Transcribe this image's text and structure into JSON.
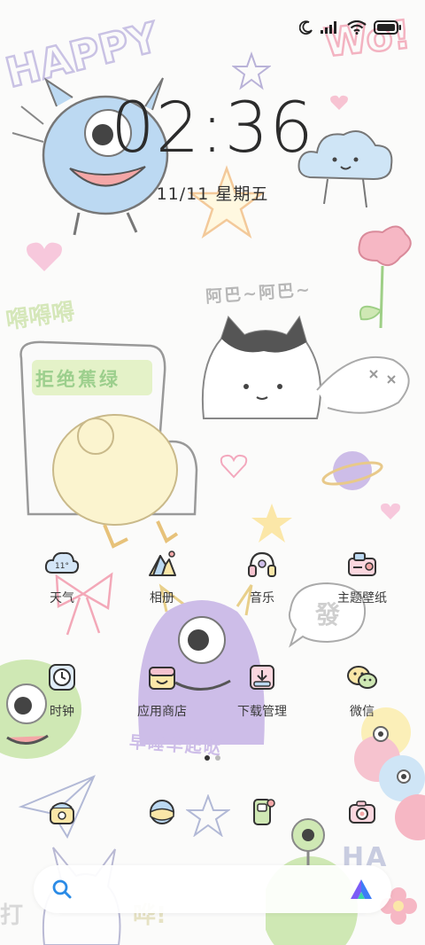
{
  "status": {
    "icons": [
      "moon-icon",
      "signal-icon",
      "wifi-icon",
      "battery-icon"
    ]
  },
  "lockscreen": {
    "time": "02:36",
    "date": "11/11 星期五"
  },
  "wallpaper_text": {
    "happy": "HAPPY",
    "wow": "Wo!",
    "aba": "阿巴~阿巴~",
    "liu": "嘚嘚嘚",
    "refuse": "拒绝蕉绿",
    "fa": "發",
    "sleep": "早睡早起哒",
    "ha": "HA",
    "da": "打",
    "hua": "哗!"
  },
  "apps": [
    {
      "label": "天气",
      "icon": "weather-icon",
      "badge": "11°"
    },
    {
      "label": "相册",
      "icon": "gallery-icon"
    },
    {
      "label": "音乐",
      "icon": "music-icon"
    },
    {
      "label": "主题壁纸",
      "icon": "theme-icon"
    },
    {
      "label": "时钟",
      "icon": "clock-icon"
    },
    {
      "label": "应用商店",
      "icon": "app-store-icon"
    },
    {
      "label": "下载管理",
      "icon": "download-icon"
    },
    {
      "label": "微信",
      "icon": "wechat-icon"
    }
  ],
  "dock": [
    {
      "icon": "phone-icon"
    },
    {
      "icon": "browser-icon"
    },
    {
      "icon": "messages-icon"
    },
    {
      "icon": "camera-icon"
    }
  ],
  "search": {
    "icon": "search-icon",
    "assistant_icon": "assistant-icon"
  },
  "colors": {
    "accent_blue": "#2b8be6",
    "doodle_blue": "#bcd9f2",
    "doodle_purple": "#cdbde8",
    "doodle_pink": "#f6c3cf",
    "doodle_yellow": "#fbefb8",
    "doodle_green": "#cfe8b4"
  }
}
